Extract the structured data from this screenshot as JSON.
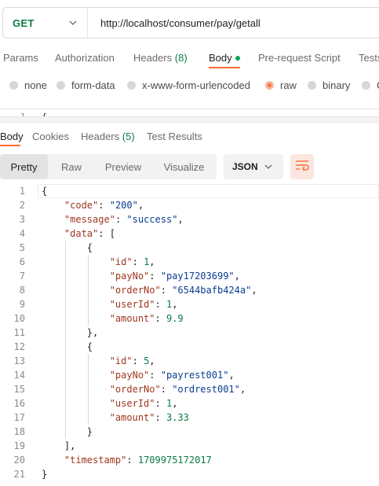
{
  "request": {
    "method": "GET",
    "url": "http://localhost/consumer/pay/getall"
  },
  "request_tabs": [
    {
      "label": "Params"
    },
    {
      "label": "Authorization"
    },
    {
      "label": "Headers",
      "count": "(8)"
    },
    {
      "label": "Body",
      "active": true
    },
    {
      "label": "Pre-request Script"
    },
    {
      "label": "Tests"
    }
  ],
  "body_types": [
    "none",
    "form-data",
    "x-www-form-urlencoded",
    "raw",
    "binary",
    "G"
  ],
  "body_type_selected": "raw",
  "editor_strip": {
    "line": "1",
    "text": "{"
  },
  "response_tabs": [
    {
      "label": "Body",
      "active": true
    },
    {
      "label": "Cookies"
    },
    {
      "label": "Headers",
      "count": "(5)"
    },
    {
      "label": "Test Results"
    }
  ],
  "view_modes": [
    "Pretty",
    "Raw",
    "Preview",
    "Visualize"
  ],
  "view_mode_selected": "Pretty",
  "format": "JSON",
  "icons": {
    "method_dropdown": "chevron-down-icon",
    "format_dropdown": "chevron-down-icon",
    "wrap": "wrap-lines-icon"
  },
  "colors": {
    "accent": "#ff6c37",
    "method": "#0b7a45",
    "key": "#a0371f",
    "string": "#0a3d91",
    "number": "#0b7a45"
  },
  "response_lines": [
    {
      "n": "1",
      "tokens": [
        [
          "p",
          "{"
        ]
      ]
    },
    {
      "n": "2",
      "tokens": [
        [
          "p",
          "    "
        ],
        [
          "k",
          "\"code\""
        ],
        [
          "p",
          ": "
        ],
        [
          "s",
          "\"200\""
        ],
        [
          "p",
          ","
        ]
      ]
    },
    {
      "n": "3",
      "tokens": [
        [
          "p",
          "    "
        ],
        [
          "k",
          "\"message\""
        ],
        [
          "p",
          ": "
        ],
        [
          "s",
          "\"success\""
        ],
        [
          "p",
          ","
        ]
      ]
    },
    {
      "n": "4",
      "tokens": [
        [
          "p",
          "    "
        ],
        [
          "k",
          "\"data\""
        ],
        [
          "p",
          ": ["
        ]
      ]
    },
    {
      "n": "5",
      "tokens": [
        [
          "p",
          "        {"
        ]
      ]
    },
    {
      "n": "6",
      "tokens": [
        [
          "p",
          "            "
        ],
        [
          "k",
          "\"id\""
        ],
        [
          "p",
          ": "
        ],
        [
          "n",
          "1"
        ],
        [
          "p",
          ","
        ]
      ]
    },
    {
      "n": "7",
      "tokens": [
        [
          "p",
          "            "
        ],
        [
          "k",
          "\"payNo\""
        ],
        [
          "p",
          ": "
        ],
        [
          "s",
          "\"pay17203699\""
        ],
        [
          "p",
          ","
        ]
      ]
    },
    {
      "n": "8",
      "tokens": [
        [
          "p",
          "            "
        ],
        [
          "k",
          "\"orderNo\""
        ],
        [
          "p",
          ": "
        ],
        [
          "s",
          "\"6544bafb424a\""
        ],
        [
          "p",
          ","
        ]
      ]
    },
    {
      "n": "9",
      "tokens": [
        [
          "p",
          "            "
        ],
        [
          "k",
          "\"userId\""
        ],
        [
          "p",
          ": "
        ],
        [
          "n",
          "1"
        ],
        [
          "p",
          ","
        ]
      ]
    },
    {
      "n": "10",
      "tokens": [
        [
          "p",
          "            "
        ],
        [
          "k",
          "\"amount\""
        ],
        [
          "p",
          ": "
        ],
        [
          "n",
          "9.9"
        ]
      ]
    },
    {
      "n": "11",
      "tokens": [
        [
          "p",
          "        },"
        ]
      ]
    },
    {
      "n": "12",
      "tokens": [
        [
          "p",
          "        {"
        ]
      ]
    },
    {
      "n": "13",
      "tokens": [
        [
          "p",
          "            "
        ],
        [
          "k",
          "\"id\""
        ],
        [
          "p",
          ": "
        ],
        [
          "n",
          "5"
        ],
        [
          "p",
          ","
        ]
      ]
    },
    {
      "n": "14",
      "tokens": [
        [
          "p",
          "            "
        ],
        [
          "k",
          "\"payNo\""
        ],
        [
          "p",
          ": "
        ],
        [
          "s",
          "\"payrest001\""
        ],
        [
          "p",
          ","
        ]
      ]
    },
    {
      "n": "15",
      "tokens": [
        [
          "p",
          "            "
        ],
        [
          "k",
          "\"orderNo\""
        ],
        [
          "p",
          ": "
        ],
        [
          "s",
          "\"ordrest001\""
        ],
        [
          "p",
          ","
        ]
      ]
    },
    {
      "n": "16",
      "tokens": [
        [
          "p",
          "            "
        ],
        [
          "k",
          "\"userId\""
        ],
        [
          "p",
          ": "
        ],
        [
          "n",
          "1"
        ],
        [
          "p",
          ","
        ]
      ]
    },
    {
      "n": "17",
      "tokens": [
        [
          "p",
          "            "
        ],
        [
          "k",
          "\"amount\""
        ],
        [
          "p",
          ": "
        ],
        [
          "n",
          "3.33"
        ]
      ]
    },
    {
      "n": "18",
      "tokens": [
        [
          "p",
          "        }"
        ]
      ]
    },
    {
      "n": "19",
      "tokens": [
        [
          "p",
          "    ],"
        ]
      ]
    },
    {
      "n": "20",
      "tokens": [
        [
          "p",
          "    "
        ],
        [
          "k",
          "\"timestamp\""
        ],
        [
          "p",
          ": "
        ],
        [
          "n",
          "1709975172017"
        ]
      ]
    },
    {
      "n": "21",
      "tokens": [
        [
          "p",
          "}"
        ]
      ]
    }
  ]
}
